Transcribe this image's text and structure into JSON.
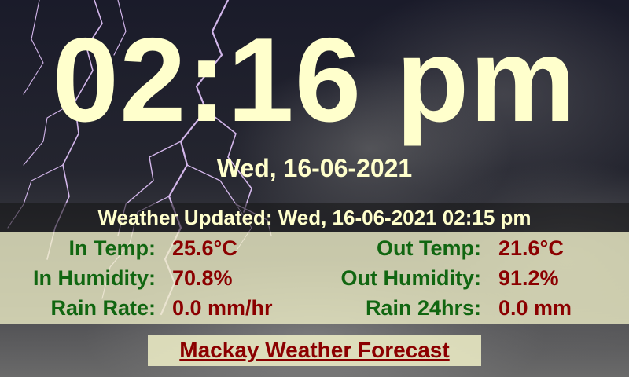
{
  "clock": {
    "time": "02:16 pm",
    "date": "Wed, 16-06-2021"
  },
  "updated": {
    "text": "Weather Updated: Wed, 16-06-2021 02:15 pm"
  },
  "readings": [
    {
      "label_left": "In Temp:",
      "value_left": "25.6°C",
      "label_right": "Out Temp:",
      "value_right": "21.6°C"
    },
    {
      "label_left": "In Humidity:",
      "value_left": "70.8%",
      "label_right": "Out Humidity:",
      "value_right": "91.2%"
    },
    {
      "label_left": "Rain Rate:",
      "value_left": "0.0 mm/hr",
      "label_right": "Rain 24hrs:",
      "value_right": "0.0 mm"
    }
  ],
  "forecast_link": {
    "label": "Mackay Weather Forecast"
  },
  "colors": {
    "text_light": "#ffffcc",
    "label_green": "#116611",
    "value_red": "#8b0000",
    "panel": "#f0f0c8"
  },
  "background": {
    "image_icon": "lightning-storm-image"
  }
}
